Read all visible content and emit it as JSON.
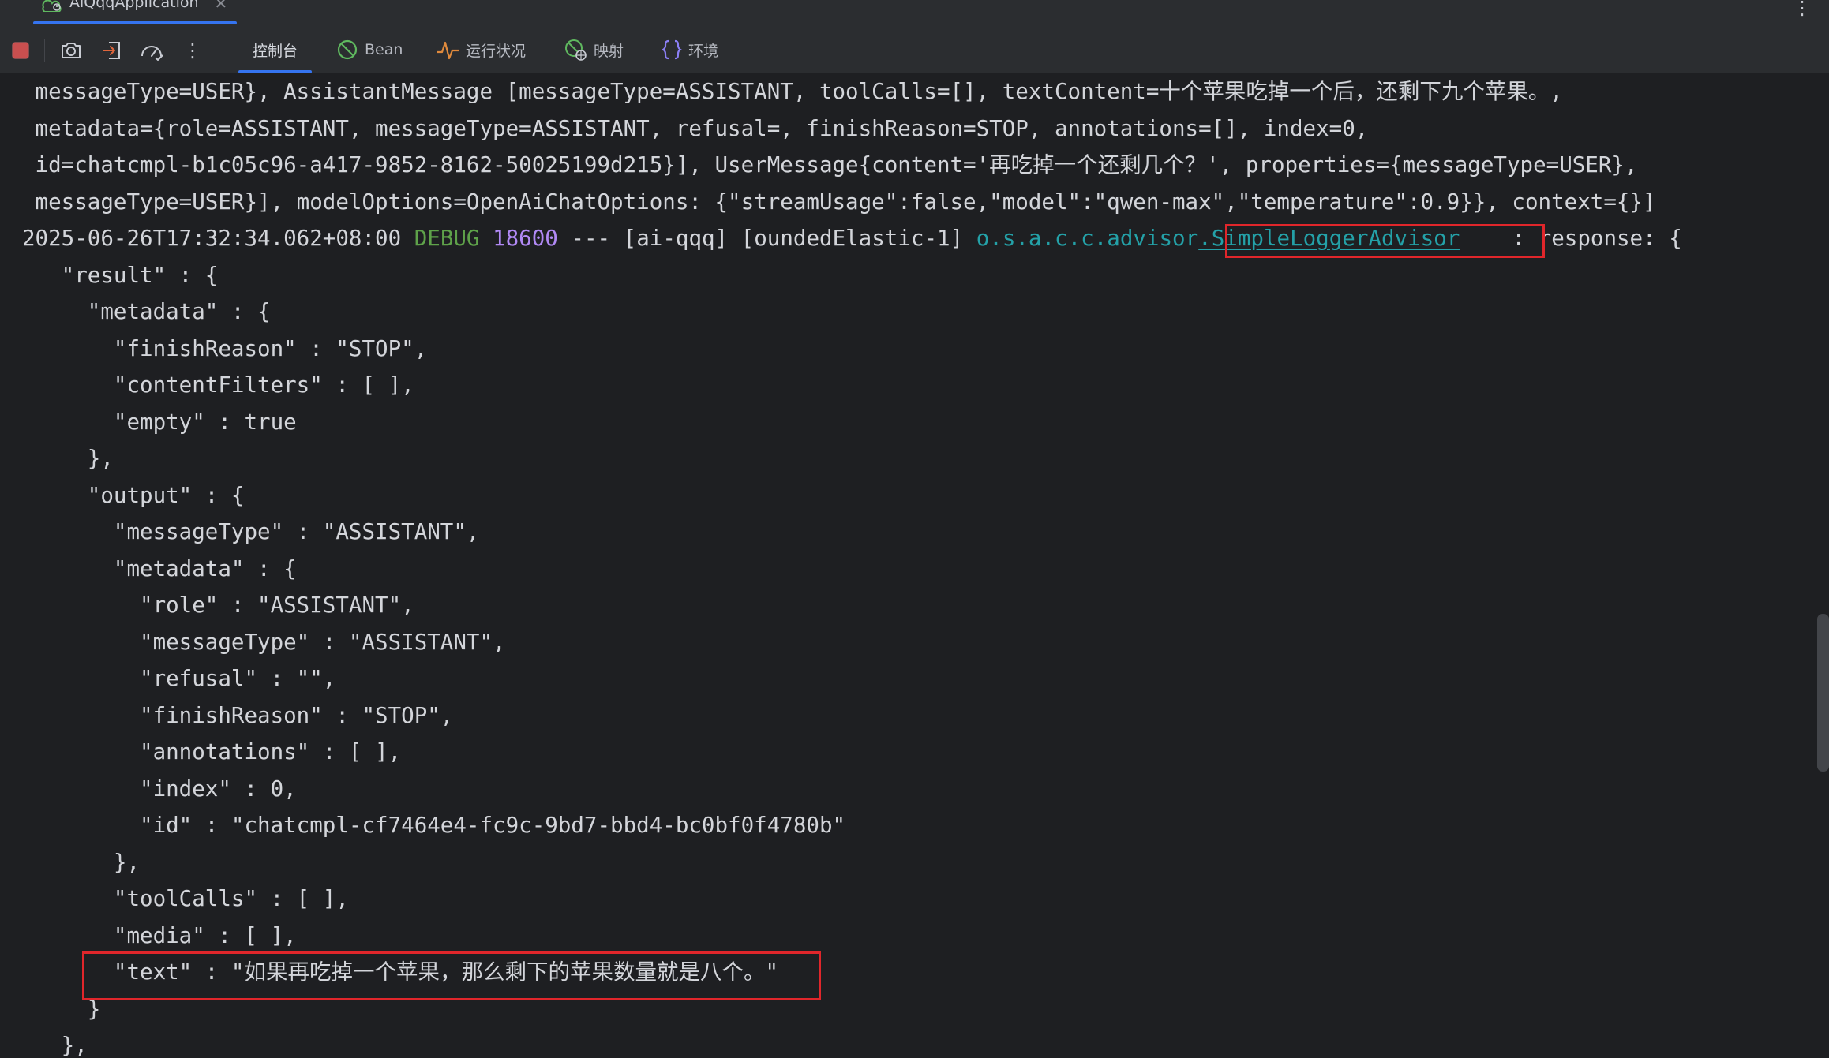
{
  "run_tab": {
    "title": "AiQqqApplication",
    "close": "✕"
  },
  "toolbar": {
    "stop_icon": "stop-icon",
    "screenshot_icon": "camera-icon",
    "exit_icon": "exit-icon",
    "dashboard_icon": "speedometer-icon",
    "more_icon": "kebab-icon",
    "more_glyph": "⋮",
    "tabs": [
      {
        "label": "控制台",
        "icon": "",
        "active": true
      },
      {
        "label": "Bean",
        "icon": "bean-icon",
        "active": false
      },
      {
        "label": "运行状况",
        "icon": "pulse-icon",
        "active": false
      },
      {
        "label": "映射",
        "icon": "globe-icon",
        "active": false
      },
      {
        "label": "环境",
        "icon": "braces-icon",
        "active": false
      }
    ]
  },
  "console": {
    "lines": [
      " messageType=USER}, AssistantMessage [messageType=ASSISTANT, toolCalls=[], textContent=十个苹果吃掉一个后，还剩下九个苹果。,",
      " metadata={role=ASSISTANT, messageType=ASSISTANT, refusal=, finishReason=STOP, annotations=[], index=0,",
      " id=chatcmpl-b1c05c96-a417-9852-8162-50025199d215}], UserMessage{content='再吃掉一个还剩几个？', properties={messageType=USER},",
      " messageType=USER}], modelOptions=OpenAiChatOptions: {\"streamUsage\":false,\"model\":\"qwen-max\",\"temperature\":0.9}}, context={}]"
    ],
    "log": {
      "timestamp": "2025-06-26T17:32:34.062+08:00",
      "level": "DEBUG",
      "pid": "18600",
      "sep": "---",
      "app": "[ai-qqq]",
      "thread": "[oundedElastic-1]",
      "logger_prefix": "o.s.a.c.c.advisor",
      "logger_class": ".SimpleLoggerAdvisor",
      "message": ": response: {"
    },
    "json_lines": [
      "   \"result\" : {",
      "     \"metadata\" : {",
      "       \"finishReason\" : \"STOP\",",
      "       \"contentFilters\" : [ ],",
      "       \"empty\" : true",
      "     },",
      "     \"output\" : {",
      "       \"messageType\" : \"ASSISTANT\",",
      "       \"metadata\" : {",
      "         \"role\" : \"ASSISTANT\",",
      "         \"messageType\" : \"ASSISTANT\",",
      "         \"refusal\" : \"\",",
      "         \"finishReason\" : \"STOP\",",
      "         \"annotations\" : [ ],",
      "         \"index\" : 0,",
      "         \"id\" : \"chatcmpl-cf7464e4-fc9c-9bd7-bbd4-bc0bf0f4780b\"",
      "       },",
      "       \"toolCalls\" : [ ],",
      "       \"media\" : [ ],",
      "       \"text\" : \"如果再吃掉一个苹果，那么剩下的苹果数量就是八个。\"",
      "     }",
      "   },"
    ]
  },
  "colors": {
    "background": "#1e1f22",
    "toolbar": "#2b2d30",
    "text": "#d3d5da",
    "debug": "#5fa24a",
    "pid": "#b189f5",
    "logger": "#24a1a8",
    "highlight": "#e0262b",
    "accent": "#3574f0"
  }
}
